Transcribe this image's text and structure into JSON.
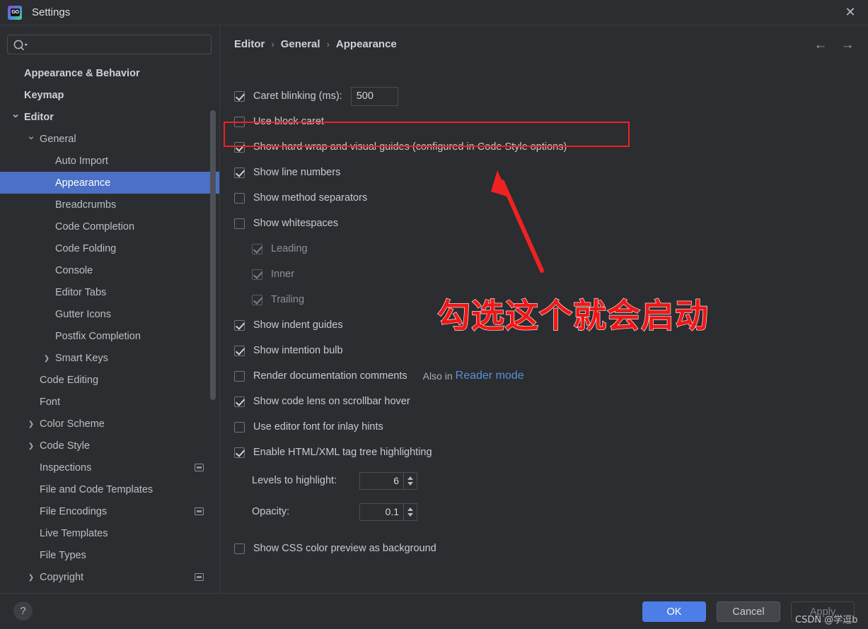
{
  "window": {
    "title": "Settings",
    "logo_text": "GO",
    "close_label": "✕"
  },
  "search": {
    "value": "",
    "placeholder": ""
  },
  "sidebar": {
    "items": [
      {
        "label": "Appearance & Behavior",
        "indent": 0,
        "bold": true,
        "arrow": "",
        "selected": false,
        "cfg": false
      },
      {
        "label": "Keymap",
        "indent": 0,
        "bold": true,
        "arrow": "",
        "selected": false,
        "cfg": false
      },
      {
        "label": "Editor",
        "indent": 0,
        "bold": true,
        "arrow": "down",
        "selected": false,
        "cfg": false
      },
      {
        "label": "General",
        "indent": 1,
        "bold": false,
        "arrow": "down",
        "selected": false,
        "cfg": false
      },
      {
        "label": "Auto Import",
        "indent": 2,
        "bold": false,
        "arrow": "",
        "selected": false,
        "cfg": false
      },
      {
        "label": "Appearance",
        "indent": 2,
        "bold": false,
        "arrow": "",
        "selected": true,
        "cfg": false
      },
      {
        "label": "Breadcrumbs",
        "indent": 2,
        "bold": false,
        "arrow": "",
        "selected": false,
        "cfg": false
      },
      {
        "label": "Code Completion",
        "indent": 2,
        "bold": false,
        "arrow": "",
        "selected": false,
        "cfg": false
      },
      {
        "label": "Code Folding",
        "indent": 2,
        "bold": false,
        "arrow": "",
        "selected": false,
        "cfg": false
      },
      {
        "label": "Console",
        "indent": 2,
        "bold": false,
        "arrow": "",
        "selected": false,
        "cfg": false
      },
      {
        "label": "Editor Tabs",
        "indent": 2,
        "bold": false,
        "arrow": "",
        "selected": false,
        "cfg": false
      },
      {
        "label": "Gutter Icons",
        "indent": 2,
        "bold": false,
        "arrow": "",
        "selected": false,
        "cfg": false
      },
      {
        "label": "Postfix Completion",
        "indent": 2,
        "bold": false,
        "arrow": "",
        "selected": false,
        "cfg": false
      },
      {
        "label": "Smart Keys",
        "indent": 2,
        "bold": false,
        "arrow": "right",
        "selected": false,
        "cfg": false
      },
      {
        "label": "Code Editing",
        "indent": 1,
        "bold": false,
        "arrow": "",
        "selected": false,
        "cfg": false
      },
      {
        "label": "Font",
        "indent": 1,
        "bold": false,
        "arrow": "",
        "selected": false,
        "cfg": false
      },
      {
        "label": "Color Scheme",
        "indent": 1,
        "bold": false,
        "arrow": "right",
        "selected": false,
        "cfg": false
      },
      {
        "label": "Code Style",
        "indent": 1,
        "bold": false,
        "arrow": "right",
        "selected": false,
        "cfg": false
      },
      {
        "label": "Inspections",
        "indent": 1,
        "bold": false,
        "arrow": "",
        "selected": false,
        "cfg": true
      },
      {
        "label": "File and Code Templates",
        "indent": 1,
        "bold": false,
        "arrow": "",
        "selected": false,
        "cfg": false
      },
      {
        "label": "File Encodings",
        "indent": 1,
        "bold": false,
        "arrow": "",
        "selected": false,
        "cfg": true
      },
      {
        "label": "Live Templates",
        "indent": 1,
        "bold": false,
        "arrow": "",
        "selected": false,
        "cfg": false
      },
      {
        "label": "File Types",
        "indent": 1,
        "bold": false,
        "arrow": "",
        "selected": false,
        "cfg": false
      },
      {
        "label": "Copyright",
        "indent": 1,
        "bold": false,
        "arrow": "right",
        "selected": false,
        "cfg": true
      }
    ]
  },
  "breadcrumb": {
    "crumb1": "Editor",
    "crumb2": "General",
    "crumb3": "Appearance",
    "separator": "›"
  },
  "nav": {
    "back": "←",
    "forward": "→"
  },
  "options": {
    "caret_blinking": {
      "label": "Caret blinking (ms):",
      "checked": true,
      "value": "500"
    },
    "use_block_caret": {
      "label": "Use block caret",
      "checked": false
    },
    "show_hard_wrap": {
      "label": "Show hard wrap and visual guides (configured in Code Style options)",
      "checked": true
    },
    "show_line_numbers": {
      "label": "Show line numbers",
      "checked": true
    },
    "show_method_separators": {
      "label": "Show method separators",
      "checked": false
    },
    "show_whitespaces": {
      "label": "Show whitespaces",
      "checked": false
    },
    "whitespace_leading": {
      "label": "Leading",
      "checked": true,
      "disabled": true
    },
    "whitespace_inner": {
      "label": "Inner",
      "checked": true,
      "disabled": true
    },
    "whitespace_trailing": {
      "label": "Trailing",
      "checked": true,
      "disabled": true
    },
    "show_indent_guides": {
      "label": "Show indent guides",
      "checked": true
    },
    "show_intention_bulb": {
      "label": "Show intention bulb",
      "checked": true
    },
    "render_doc_comments": {
      "label": "Render documentation comments",
      "checked": false,
      "note": "Also in",
      "link": "Reader mode"
    },
    "show_code_lens": {
      "label": "Show code lens on scrollbar hover",
      "checked": true
    },
    "use_editor_font_inlay": {
      "label": "Use editor font for inlay hints",
      "checked": false
    },
    "enable_tag_tree": {
      "label": "Enable HTML/XML tag tree highlighting",
      "checked": true
    },
    "levels_to_highlight": {
      "label": "Levels to highlight:",
      "value": "6"
    },
    "opacity": {
      "label": "Opacity:",
      "value": "0.1"
    },
    "show_css_color_preview": {
      "label": "Show CSS color preview as background",
      "checked": false
    }
  },
  "annotations": {
    "chinese_note": "勾选这个就会启动",
    "highlight_color": "#ef2020",
    "arrow_color": "#ee2222",
    "watermark": "CSDN @学逗b"
  },
  "footer": {
    "help": "?",
    "ok": "OK",
    "cancel": "Cancel",
    "apply": "Apply"
  }
}
